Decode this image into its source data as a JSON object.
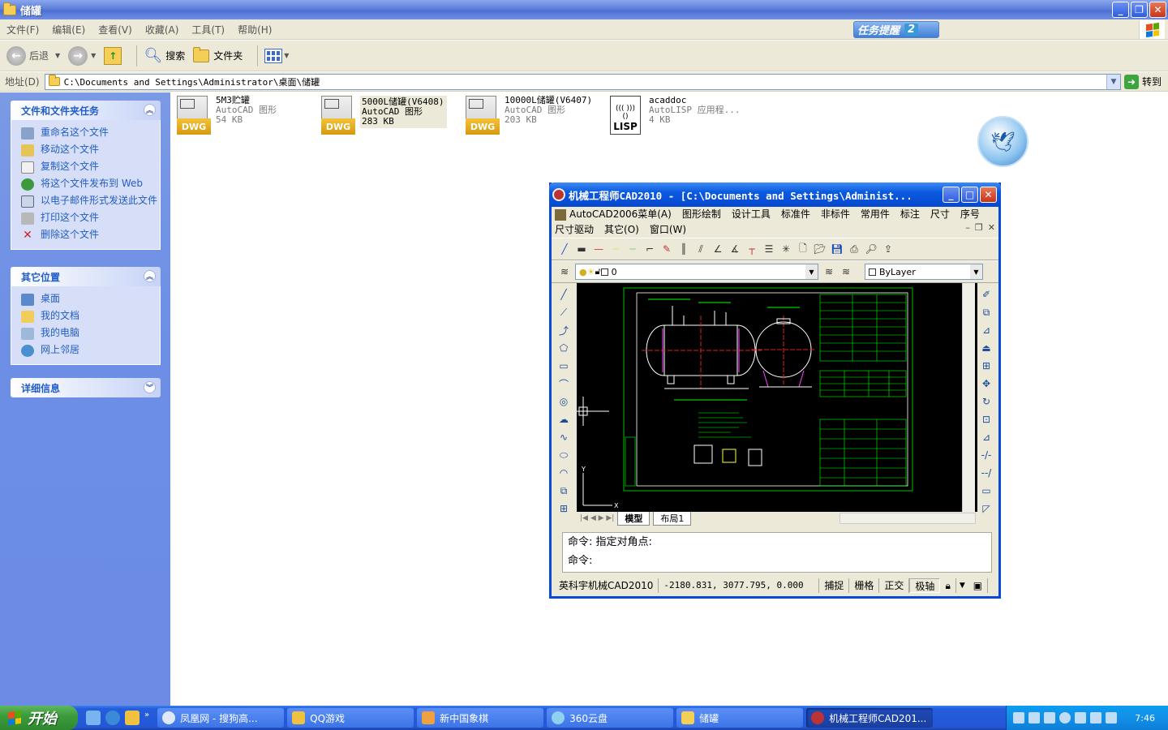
{
  "window": {
    "title": "储罐"
  },
  "menu": [
    "文件(F)",
    "编辑(E)",
    "查看(V)",
    "收藏(A)",
    "工具(T)",
    "帮助(H)"
  ],
  "task_reminder": {
    "label": "任务提醒",
    "count": "2"
  },
  "toolbar": {
    "back": "后退",
    "search": "搜索",
    "folders": "文件夹"
  },
  "address": {
    "label": "地址(D)",
    "value": "C:\\Documents and Settings\\Administrator\\桌面\\储罐",
    "go": "转到"
  },
  "tasks_panel": {
    "title": "文件和文件夹任务",
    "items": [
      "重命名这个文件",
      "移动这个文件",
      "复制这个文件",
      "将这个文件发布到 Web",
      "以电子邮件形式发送此文件",
      "打印这个文件",
      "删除这个文件"
    ]
  },
  "places_panel": {
    "title": "其它位置",
    "items": [
      "桌面",
      "我的文档",
      "我的电脑",
      "网上邻居"
    ]
  },
  "details_panel": {
    "title": "详细信息"
  },
  "files": [
    {
      "name": "5M3贮罐",
      "type": "AutoCAD 图形",
      "size": "54 KB",
      "icon": "DWG"
    },
    {
      "name": "5000L储罐(V6408)",
      "type": "AutoCAD 图形",
      "size": "283 KB",
      "icon": "DWG"
    },
    {
      "name": "10000L储罐(V6407)",
      "type": "AutoCAD 图形",
      "size": "203 KB",
      "icon": "DWG"
    },
    {
      "name": "acaddoc",
      "type": "AutoLISP 应用程...",
      "size": "4 KB",
      "icon": "LISP"
    }
  ],
  "cad": {
    "title": "机械工程师CAD2010 - [C:\\Documents and Settings\\Administ...",
    "menu_row1": [
      "AutoCAD2006菜单(A)",
      "图形绘制",
      "设计工具",
      "标准件",
      "非标件",
      "常用件",
      "标注",
      "尺寸",
      "序号"
    ],
    "menu_row2": [
      "尺寸驱动",
      "其它(O)",
      "窗口(W)"
    ],
    "layer": "0",
    "linetype": "ByLayer",
    "tabs": [
      "模型",
      "布局1"
    ],
    "cmd_line1": "命令: 指定对角点:",
    "cmd_line2": "命令:",
    "status_app": "英科宇机械CAD2010",
    "coords": "-2180.831, 3077.795, 0.000",
    "status_buttons": [
      "捕捉",
      "栅格",
      "正交",
      "极轴"
    ]
  },
  "taskbar": {
    "start": "开始",
    "buttons": [
      "凤凰网 - 搜狗高...",
      "QQ游戏",
      "新中国象棋",
      "360云盘",
      "储罐",
      "机械工程师CAD201..."
    ],
    "active_index": 5,
    "clock": "7:46"
  }
}
